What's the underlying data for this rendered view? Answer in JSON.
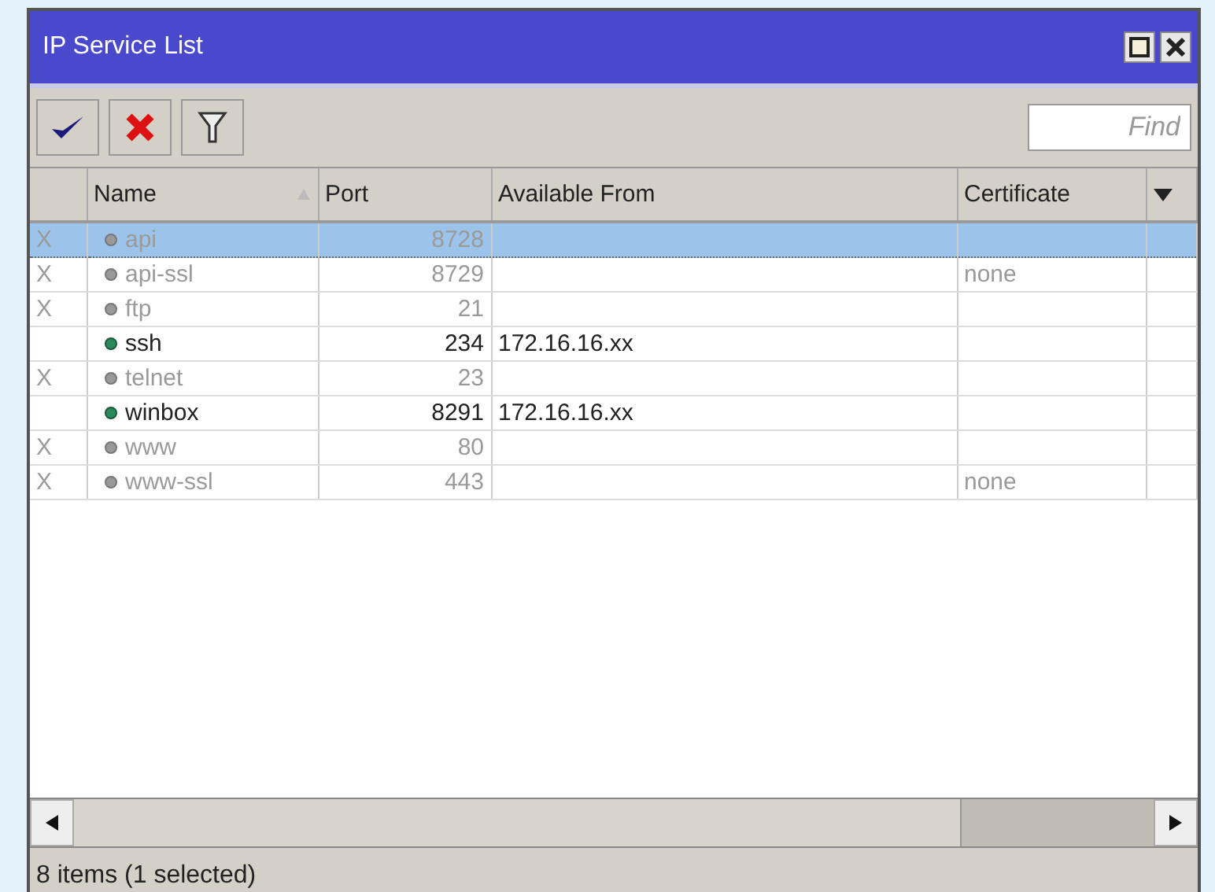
{
  "window": {
    "title": "IP Service List"
  },
  "toolbar": {
    "find": {
      "placeholder": "Find"
    }
  },
  "table": {
    "columns": [
      {
        "label": "Name",
        "sorted": true
      },
      {
        "label": "Port",
        "sorted": false
      },
      {
        "label": "Available From",
        "sorted": false
      },
      {
        "label": "Certificate",
        "sorted": false
      }
    ],
    "rows": [
      {
        "flag": "X",
        "name": "api",
        "port": "8728",
        "available_from": "",
        "certificate": "",
        "disabled": true,
        "selected": true
      },
      {
        "flag": "X",
        "name": "api-ssl",
        "port": "8729",
        "available_from": "",
        "certificate": "none",
        "disabled": true,
        "selected": false
      },
      {
        "flag": "X",
        "name": "ftp",
        "port": "21",
        "available_from": "",
        "certificate": "",
        "disabled": true,
        "selected": false
      },
      {
        "flag": "",
        "name": "ssh",
        "port": "234",
        "available_from": "172.16.16.xx",
        "certificate": "",
        "disabled": false,
        "selected": false
      },
      {
        "flag": "X",
        "name": "telnet",
        "port": "23",
        "available_from": "",
        "certificate": "",
        "disabled": true,
        "selected": false
      },
      {
        "flag": "",
        "name": "winbox",
        "port": "8291",
        "available_from": "172.16.16.xx",
        "certificate": "",
        "disabled": false,
        "selected": false
      },
      {
        "flag": "X",
        "name": "www",
        "port": "80",
        "available_from": "",
        "certificate": "",
        "disabled": true,
        "selected": false
      },
      {
        "flag": "X",
        "name": "www-ssl",
        "port": "443",
        "available_from": "",
        "certificate": "none",
        "disabled": true,
        "selected": false
      }
    ]
  },
  "status_bar": "8 items (1 selected)"
}
